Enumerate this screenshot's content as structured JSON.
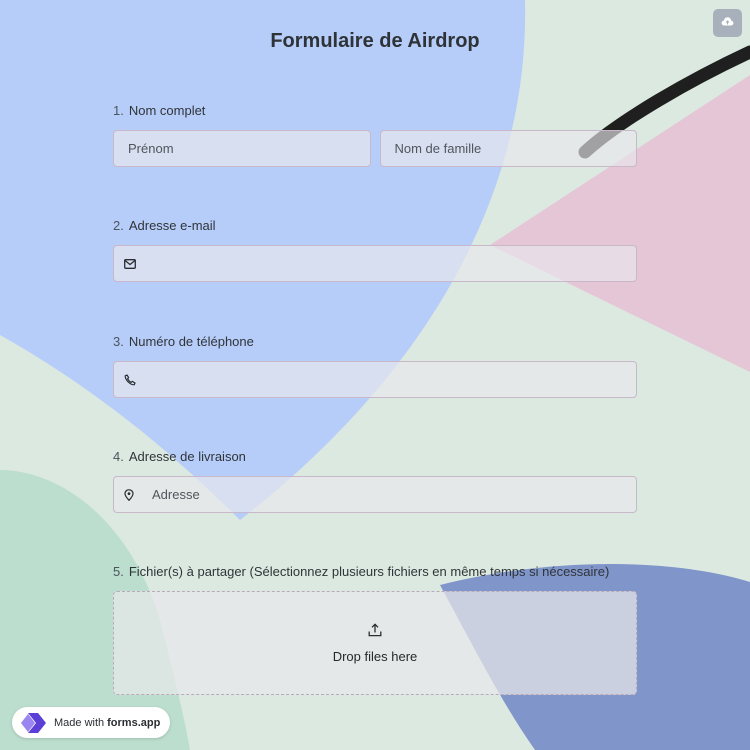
{
  "form": {
    "title": "Formulaire de Airdrop"
  },
  "questions": [
    {
      "number": "1.",
      "label": "Nom complet",
      "fields": [
        {
          "placeholder": "Prénom"
        },
        {
          "placeholder": "Nom de famille"
        }
      ]
    },
    {
      "number": "2.",
      "label": "Adresse e-mail",
      "icon": "envelope-icon",
      "placeholder": ""
    },
    {
      "number": "3.",
      "label": "Numéro de téléphone",
      "icon": "phone-icon",
      "placeholder": ""
    },
    {
      "number": "4.",
      "label": "Adresse de livraison",
      "icon": "map-pin-icon",
      "placeholder": "Adresse"
    },
    {
      "number": "5.",
      "label": "Fichier(s) à partager (Sélectionnez plusieurs fichiers en même temps si nécessaire)",
      "icon": "upload-icon",
      "drop_text": "Drop files here"
    }
  ],
  "badge": {
    "prefix": "Made with",
    "brand": "forms.app"
  },
  "toolbar": {
    "icon": "cloud-upload-icon"
  },
  "colors": {
    "background": "#dce9e0",
    "blue_shape": "#b7cdf9",
    "pink_shape": "#e5c6d6",
    "navy_shape": "#8095c9",
    "teal_shape": "#bcdece",
    "field_border": "#c9b8c9",
    "brand_purple": "#5b3fd6"
  }
}
